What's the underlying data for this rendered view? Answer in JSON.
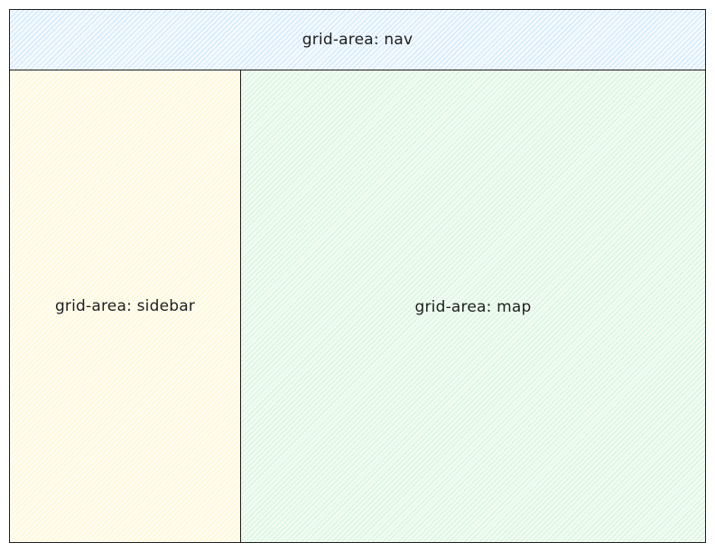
{
  "diagram": {
    "nav_label": "grid-area: nav",
    "sidebar_label": "grid-area: sidebar",
    "map_label": "grid-area: map"
  },
  "colors": {
    "stroke": "#1e1e1e",
    "nav_fill": "#a5d8ff",
    "sidebar_fill": "#ffec99",
    "map_fill": "#b2f2bb"
  }
}
